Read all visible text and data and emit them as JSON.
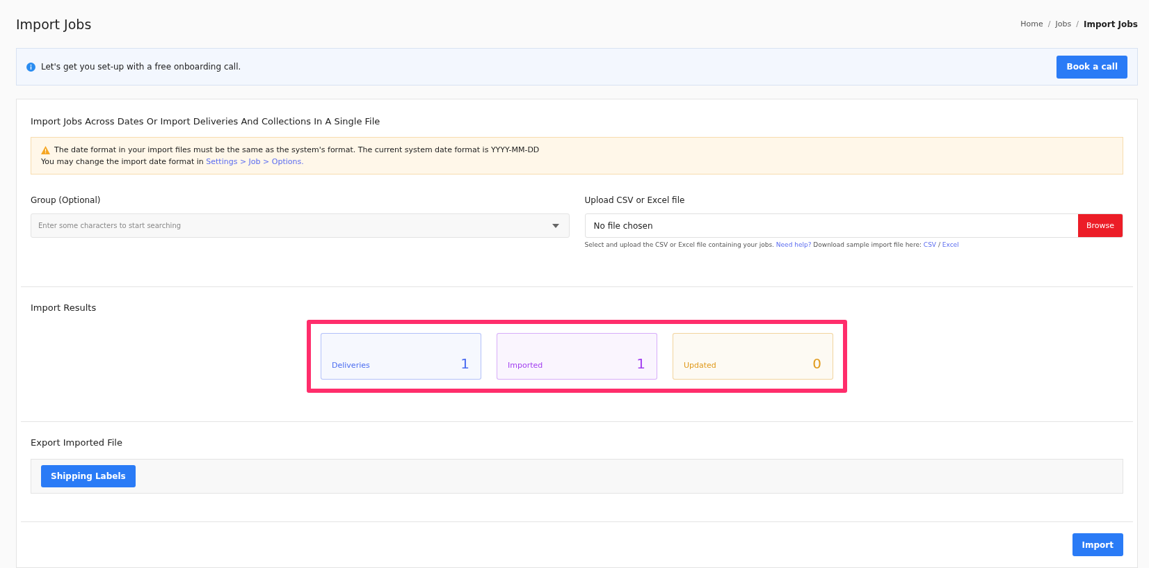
{
  "page_title": "Import Jobs",
  "breadcrumbs": [
    {
      "label": "Home",
      "active": false
    },
    {
      "label": "Jobs",
      "active": false
    },
    {
      "label": "Import Jobs",
      "active": true
    }
  ],
  "breadcrumb_separator": "/",
  "onboarding_banner": {
    "message": "Let's get you set-up with a free onboarding call.",
    "button": "Book a call"
  },
  "import_section": {
    "title": "Import Jobs Across Dates Or Import Deliveries And Collections In A Single File",
    "warning": {
      "line_1": "The date format in your import files must be the same as the system's format. The current system date format is YYYY-MM-DD",
      "line_2": "You may change the import date format in",
      "link": "Settings > Job > Options."
    },
    "group_field": {
      "label": "Group (Optional)",
      "placeholder": "Enter some characters to start searching"
    },
    "upload_field": {
      "label": "Upload CSV or Excel file",
      "value": "No file chosen",
      "button": "Browse",
      "help_text": "Select and upload the CSV or Excel file containing your jobs.",
      "help_link": "Need help?",
      "sample_text": "Download sample import file here:",
      "sample_links": [
        "CSV",
        "Excel"
      ],
      "sample_separator": "/"
    }
  },
  "import_results": {
    "title": "Import Results",
    "highlighted": true,
    "stats": [
      {
        "label": "Deliveries",
        "value": "1",
        "color": "#4b6cf0"
      },
      {
        "label": "Imported",
        "value": "1",
        "color": "#a23ef0"
      },
      {
        "label": "Updated",
        "value": "0",
        "color": "#e09a1c"
      }
    ]
  },
  "export_section": {
    "title": "Export Imported File",
    "buttons": [
      "Shipping Labels"
    ]
  },
  "footer_button": "Import"
}
